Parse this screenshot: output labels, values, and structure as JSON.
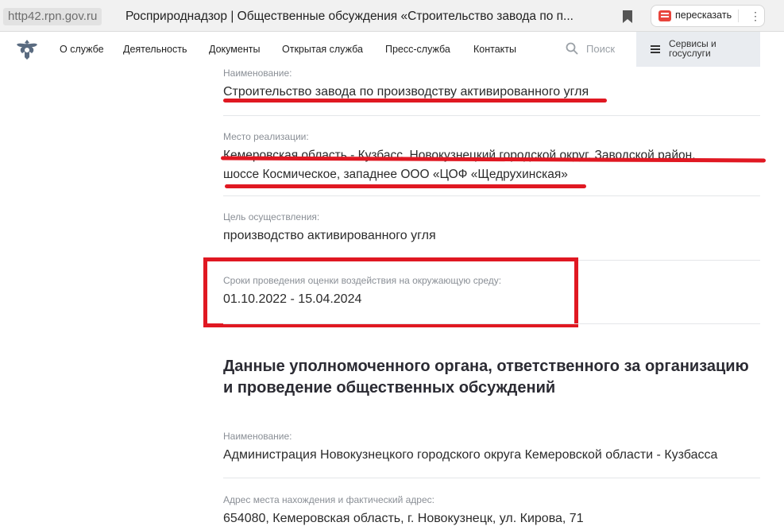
{
  "browser": {
    "url_domain": "http42.rpn.gov.ru",
    "tab_title": "Росприроднадзор | Общественные обсуждения «Строительство завода по п...",
    "retell_label": "пересказать",
    "more_symbol": "⋮"
  },
  "nav": {
    "items": [
      "О службе",
      "Деятельность",
      "Документы",
      "Открытая служба",
      "Пресс-служба",
      "Контакты"
    ],
    "search_label": "Поиск",
    "services_label_1": "Сервисы и",
    "services_label_2": "госуслуги"
  },
  "object": {
    "name_label": "Наименование:",
    "name_value": "Строительство завода по производству активированного угля",
    "place_label": "Место реализации:",
    "place_value_line1": "Кемеровская область - Кузбасс, Новокузнецкий городской округ, Заводской район,",
    "place_value_line2": "шоссе Космическое, западнее ООО «ЦОФ «Щедрухинская»",
    "purpose_label": "Цель осуществления:",
    "purpose_value": "производство активированного угля",
    "period_label": "Сроки проведения оценки воздействия на окружающую среду:",
    "period_value": "01.10.2022 - 15.04.2024"
  },
  "authority": {
    "heading_line1": "Данные уполномоченного органа, ответственного за организацию",
    "heading_line2": "и проведение общественных обсуждений",
    "name_label": "Наименование:",
    "name_value": "Администрация Новокузнецкого городского округа Кемеровской области - Кузбасса",
    "address_label": "Адрес места нахождения и фактический адрес:",
    "address_value": "654080, Кемеровская область, г. Новокузнецк, ул. Кирова, 71"
  },
  "colors": {
    "annotation_red": "#e01822",
    "services_bg": "#e9ecf0"
  }
}
